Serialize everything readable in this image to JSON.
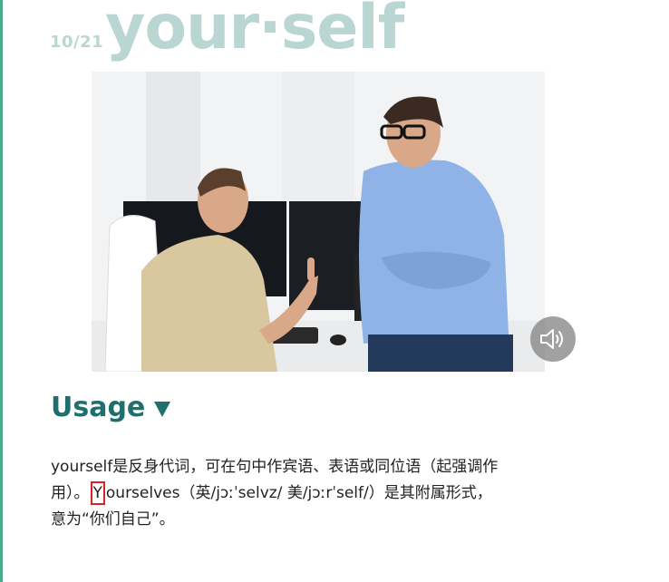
{
  "header": {
    "counter": "10/21",
    "word": "your·self"
  },
  "photo": {
    "alt": "two men talking in office"
  },
  "speaker": {
    "icon": "speaker-icon"
  },
  "usage": {
    "title": "Usage",
    "text_line1": "yourself是反身代词，可在句中作宾语、表语或同位语（起强调作",
    "text_line2_before": "用）。",
    "text_line2_highlight": "Y",
    "text_line2_after": "ourselves（英/jɔːˈselvz/ 美/jɔːrˈself/）是其附属形式，",
    "text_line3": "意为“你们自己”。"
  },
  "colors": {
    "accent": "#1f6f6c",
    "word": "#b9d6d3",
    "highlight_border": "#e02020"
  }
}
